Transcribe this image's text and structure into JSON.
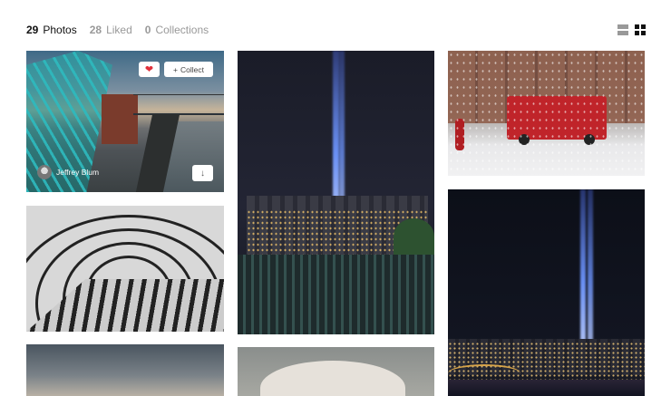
{
  "tabs": [
    {
      "count": "29",
      "label": "Photos",
      "active": true
    },
    {
      "count": "28",
      "label": "Liked",
      "active": false
    },
    {
      "count": "0",
      "label": "Collections",
      "active": false
    }
  ],
  "view_toggles": [
    "list-view-icon",
    "grid-view-icon"
  ],
  "photos": [
    {
      "subject": "Brooklyn waterfront with cranes and bridge",
      "hovered": true,
      "overlay": {
        "like_icon": "heart-icon",
        "collect_label": "Collect",
        "collect_icon": "plus-icon",
        "author": "Jeffrey Blum",
        "download_icon": "download-arrow-icon"
      }
    },
    {
      "subject": "Black and white curved steel walkway"
    },
    {
      "subject": "Cloudy sky over water"
    },
    {
      "subject": "Tribute in Light beams over skyline at night with pier pilings"
    },
    {
      "subject": "Cat face"
    },
    {
      "subject": "Fire truck in snowy street"
    },
    {
      "subject": "Tribute in Light beams over city at night"
    }
  ],
  "colors": {
    "active_tab": "#111111",
    "inactive_tab": "#999999",
    "like_heart": "#e0303b"
  }
}
